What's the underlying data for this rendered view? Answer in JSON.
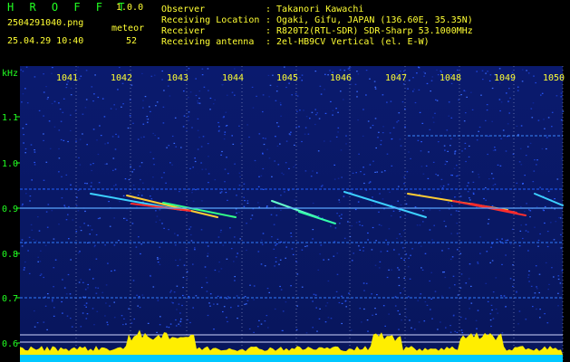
{
  "header": {
    "app_title": "H R O F F T",
    "version": "1.0.0",
    "filename": "2504291040.png",
    "datetime": "25.04.29 10:40",
    "meteor_label": "meteor",
    "meteor_count": "52"
  },
  "info": [
    {
      "label": "Observer",
      "value": ": Takanori Kawachi"
    },
    {
      "label": "Receiving Location",
      "value": ": Ogaki, Gifu, JAPAN (136.60E, 35.35N)"
    },
    {
      "label": "Receiver",
      "value": ": R820T2(RTL-SDR) SDR-Sharp 53.1000MHz"
    },
    {
      "label": "Receiving antenna",
      "value": ": 2el-HB9CV Vertical (el. E-W)"
    }
  ],
  "spectrogram": {
    "y_unit": "kHz",
    "y_ticks": [
      "1.1",
      "1.0",
      "0.9",
      "0.8",
      "0.7",
      "0.6"
    ],
    "x_ticks": [
      "1041",
      "1042",
      "1043",
      "1044",
      "1045",
      "1046",
      "1047",
      "1048",
      "1049",
      "1050"
    ]
  },
  "colors": {
    "background": "#000000",
    "text_green": "#22ff22",
    "text_yellow": "#ffff33",
    "grid": "#ffffff",
    "echo_hot": "#ff2020",
    "baseline_cyan": "#00c8ff",
    "noise_yellow": "#ffee00"
  }
}
